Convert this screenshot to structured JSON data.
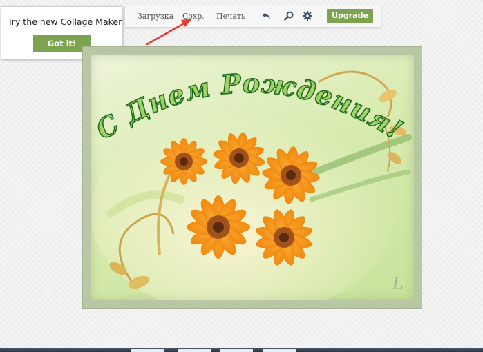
{
  "toolbar": {
    "items": [
      "Загрузка",
      "Сохр.",
      "Печать"
    ],
    "icons": [
      "undo-icon",
      "search-icon",
      "gear-icon"
    ],
    "upgrade_label": "Upgrade"
  },
  "tooltip": {
    "text": "Try the new Collage Maker",
    "button_label": "Got it!"
  },
  "card": {
    "greeting": "С Днем Рождения!",
    "signature": "L"
  },
  "colors": {
    "accent_green": "#7ca34f",
    "arrow_red": "#e53935",
    "card_frame": "#b9c7a6",
    "flower_orange": "#f5a623"
  }
}
